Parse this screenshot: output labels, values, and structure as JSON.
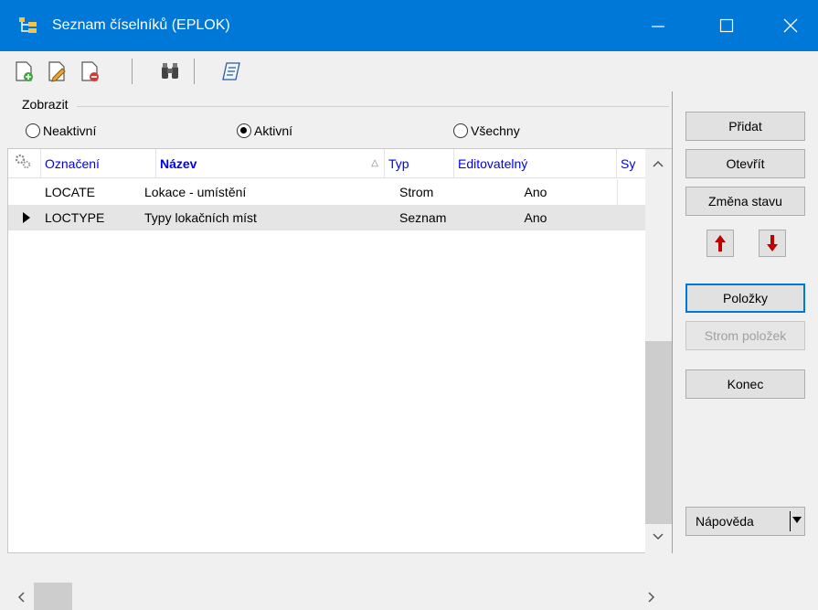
{
  "window": {
    "title": "Seznam číselníků (EPLOK)",
    "accent": "#0078d7"
  },
  "toolbar": {
    "icons": [
      "new-document-icon",
      "edit-document-icon",
      "delete-document-icon",
      "binoculars-icon",
      "print-list-icon"
    ]
  },
  "filter": {
    "group_label": "Zobrazit",
    "options": [
      {
        "label": "Neaktivní",
        "checked": false
      },
      {
        "label": "Aktivní",
        "checked": true
      },
      {
        "label": "Všechny",
        "checked": false
      }
    ]
  },
  "grid": {
    "columns": [
      "Označení",
      "Název",
      "Typ",
      "Editovatelný",
      "Sy"
    ],
    "sorted_column": "Název",
    "rows": [
      {
        "code": "LOCATE",
        "name": "Lokace - umístění",
        "type": "Strom",
        "editable": "Ano",
        "selected": false
      },
      {
        "code": "LOCTYPE",
        "name": "Typy lokačních míst",
        "type": "Seznam",
        "editable": "Ano",
        "selected": true
      }
    ]
  },
  "buttons": {
    "add": "Přidat",
    "open": "Otevřít",
    "change_state": "Změna stavu",
    "items": "Položky",
    "item_tree": "Strom položek",
    "end": "Konec",
    "help": "Nápověda"
  },
  "colors": {
    "header_text": "#0000ee",
    "arrow_red": "#c00000"
  }
}
